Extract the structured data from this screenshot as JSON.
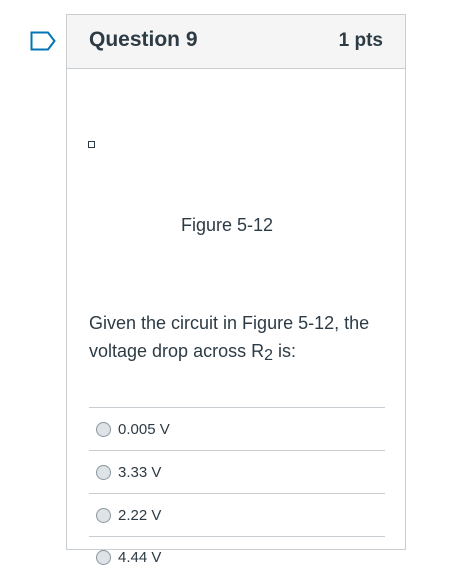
{
  "question": {
    "title": "Question 9",
    "points": "1 pts",
    "figure_caption": "Figure 5-12",
    "text_before_sub": "Given the circuit in Figure 5-12, the voltage drop across R",
    "text_sub": "2",
    "text_after_sub": " is:"
  },
  "answers": [
    {
      "label": "0.005 V"
    },
    {
      "label": "3.33 V"
    },
    {
      "label": "2.22 V"
    },
    {
      "label": "4.44 V"
    }
  ],
  "icons": {
    "flag": "bookmark-flag-icon",
    "image": "broken-image-icon",
    "radio": "radio-button-icon"
  },
  "colors": {
    "text": "#2d3b45",
    "border": "#c7cdd1",
    "header_bg": "#f5f5f5",
    "flag": "#0374b5"
  }
}
